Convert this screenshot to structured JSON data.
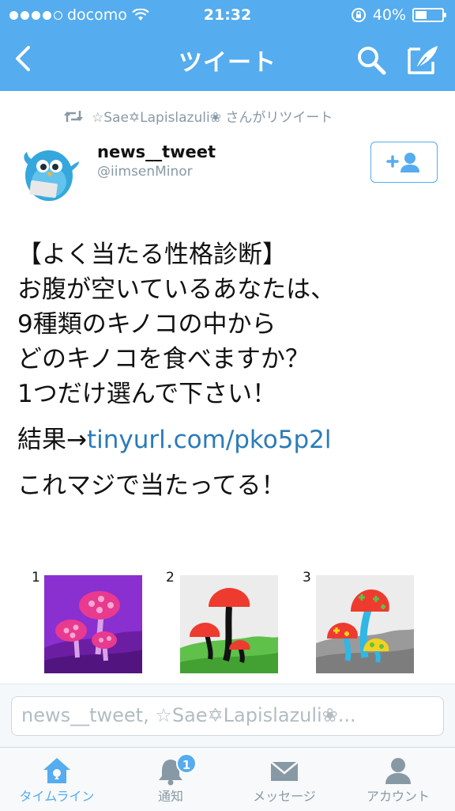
{
  "status_bar": {
    "carrier": "docomo",
    "time": "21:32",
    "battery": "40%",
    "battery_level": 0.4
  },
  "nav": {
    "title": "ツイート"
  },
  "retweet": {
    "text": "☆Sae✡Lapislazuli❀ さんがリツイート"
  },
  "author": {
    "name": "news__tweet",
    "handle": "@iimsenMinor"
  },
  "tweet": {
    "lines": [
      "【よく当たる性格診断】",
      "お腹が空いているあなたは、",
      "9種類のキノコの中から",
      "どのキノコを食べますか？",
      "1つだけ選んで下さい！"
    ],
    "result_prefix": "結果→",
    "result_link": "tinyurl.com/pko5p2l",
    "last_line": "これマジで当たってる！"
  },
  "images": [
    {
      "number": "1"
    },
    {
      "number": "2"
    },
    {
      "number": "3"
    }
  ],
  "reply": {
    "placeholder": "news__tweet, ☆Sae✡Lapislazuli❀..."
  },
  "tabs": [
    {
      "label": "タイムライン",
      "icon": "home-icon",
      "active": true
    },
    {
      "label": "通知",
      "icon": "bell-icon",
      "badge": "1"
    },
    {
      "label": "メッセージ",
      "icon": "envelope-icon"
    },
    {
      "label": "アカウント",
      "icon": "person-icon"
    }
  ],
  "colors": {
    "brand": "#55acee",
    "link": "#2b7bb9",
    "muted": "#8899a6"
  }
}
